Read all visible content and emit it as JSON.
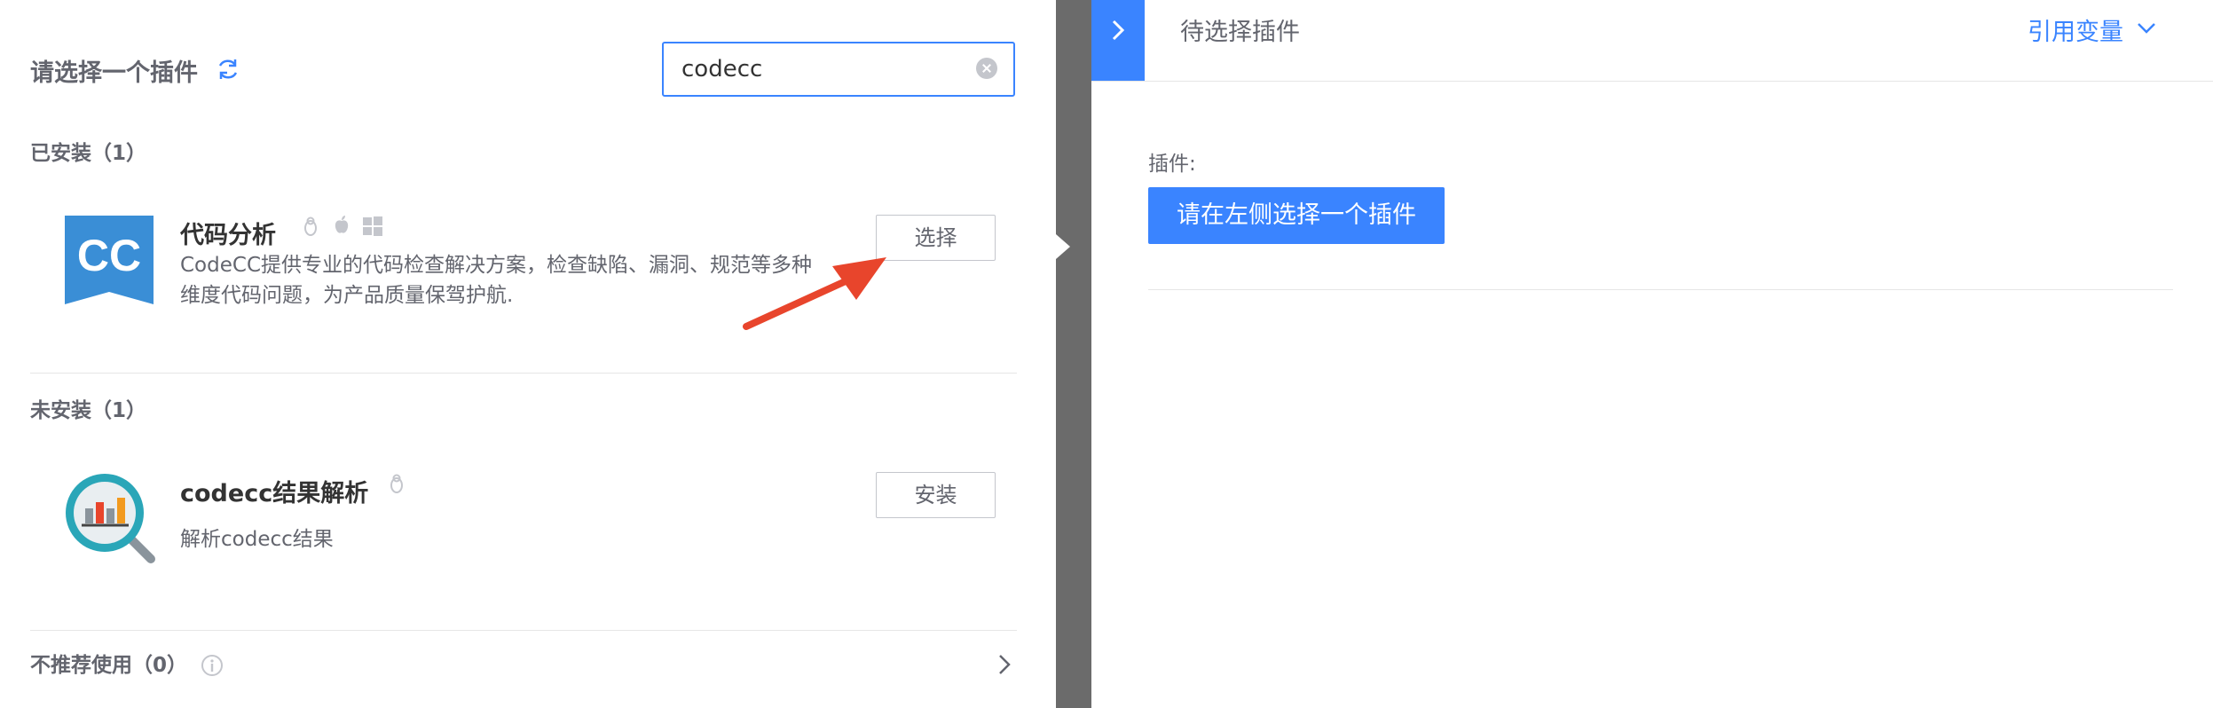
{
  "left_panel": {
    "title": "请选择一个插件",
    "search": {
      "value": "codecc"
    },
    "installed": {
      "title": "已安装（1）",
      "items": [
        {
          "name": "代码分析",
          "description_line1": "CodeCC提供专业的代码检查解决方案，检查缺陷、漏洞、规范等多种",
          "description_line2": "维度代码问题，为产品质量保驾护航.",
          "logo_text": "CC",
          "os_icons": [
            "linux-icon",
            "apple-icon",
            "windows-icon"
          ],
          "button_label": "选择"
        }
      ]
    },
    "uninstalled": {
      "title": "未安装（1）",
      "items": [
        {
          "name": "codecc结果解析",
          "description": "解析codecc结果",
          "os_icons": [
            "linux-icon"
          ],
          "button_label": "安装"
        }
      ]
    },
    "deprecated": {
      "title": "不推荐使用（0）"
    }
  },
  "right_panel": {
    "header_title": "待选择插件",
    "ref_var_label": "引用变量",
    "plugin_label": "插件:",
    "choose_button_label": "请在左侧选择一个插件"
  },
  "colors": {
    "accent": "#3a84ff",
    "annotation_arrow": "#e8452c",
    "logo_blue": "#3a8ed6"
  }
}
